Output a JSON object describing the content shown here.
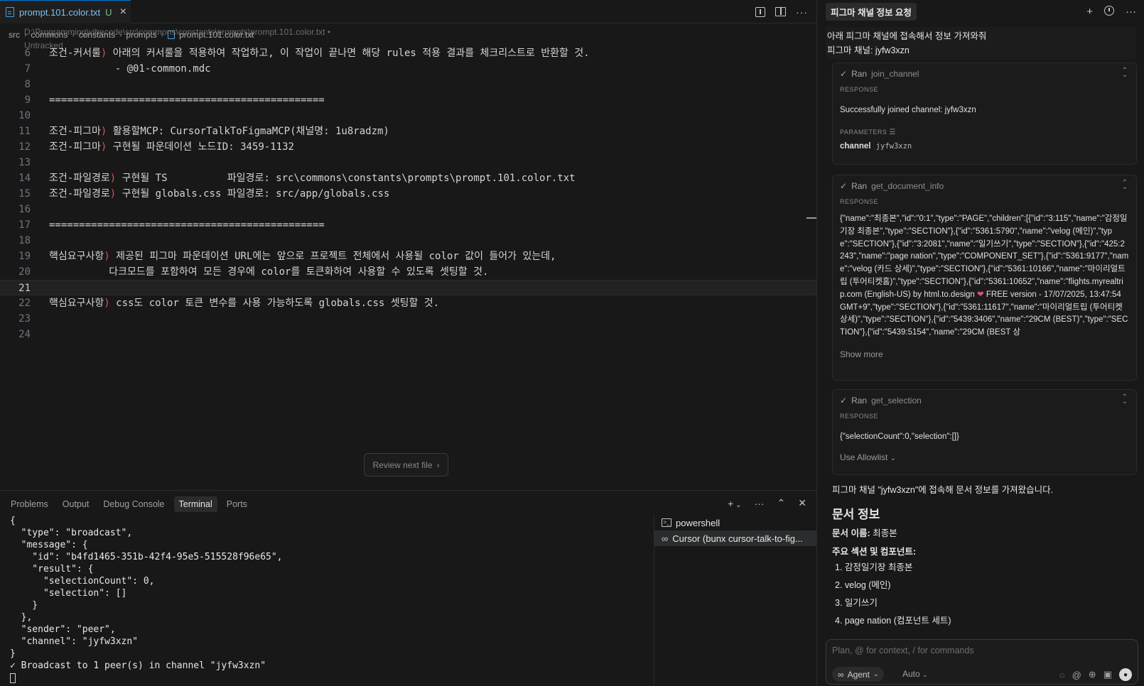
{
  "editor": {
    "tab": {
      "name": "prompt.101.color.txt",
      "status": "U"
    },
    "breadcrumb": [
      "src",
      "commons",
      "constants",
      "prompts",
      "prompt.101.color.txt"
    ],
    "hover_path": "D:\\Programming\\vibecode\\src\\commons\\constants\\prompts\\prompt.101.color.txt •",
    "hover_status": "Untracked",
    "lines": [
      {
        "n": "6",
        "kw": "조건-커서룰)",
        "text": " 아래의 커서룰을 적용하여 작업하고, 이 작업이 끝나면 해당 rules 적용 결과를 체크리스트로 반환할 것."
      },
      {
        "n": "7",
        "kw": "",
        "text": "           - @01-common.mdc"
      },
      {
        "n": "8",
        "kw": "",
        "text": ""
      },
      {
        "n": "9",
        "kw": "",
        "text": "=============================================="
      },
      {
        "n": "10",
        "kw": "",
        "text": ""
      },
      {
        "n": "11",
        "kw": "조건-피그마)",
        "text": " 활용할MCP: CursorTalkToFigmaMCP(채널명: 1u8radzm)"
      },
      {
        "n": "12",
        "kw": "조건-피그마)",
        "text": " 구현될 파운데이션 노드ID: 3459-1132"
      },
      {
        "n": "13",
        "kw": "",
        "text": ""
      },
      {
        "n": "14",
        "kw": "조건-파일경로)",
        "text": " 구현될 TS          파일경로: src\\commons\\constants\\prompts\\prompt.101.color.txt"
      },
      {
        "n": "15",
        "kw": "조건-파일경로)",
        "text": " 구현될 globals.css 파일경로: src/app/globals.css"
      },
      {
        "n": "16",
        "kw": "",
        "text": ""
      },
      {
        "n": "17",
        "kw": "",
        "text": "=============================================="
      },
      {
        "n": "18",
        "kw": "",
        "text": ""
      },
      {
        "n": "19",
        "kw": "핵심요구사항)",
        "text": " 제공된 피그마 파운데이션 URL에는 앞으로 프로젝트 전체에서 사용될 color 값이 들어가 있는데,"
      },
      {
        "n": "20",
        "kw": "",
        "text": "          다크모드를 포함하여 모든 경우에 color를 토큰화하여 사용할 수 있도록 셋팅할 것."
      },
      {
        "n": "21",
        "kw": "",
        "text": ""
      },
      {
        "n": "22",
        "kw": "핵심요구사항)",
        "text": " css도 color 토큰 변수를 사용 가능하도록 globals.css 셋팅할 것."
      },
      {
        "n": "23",
        "kw": "",
        "text": ""
      },
      {
        "n": "24",
        "kw": "",
        "text": ""
      }
    ],
    "review_button": "Review next file",
    "review_chevron": "›"
  },
  "panel": {
    "tabs": [
      "Problems",
      "Output",
      "Debug Console",
      "Terminal",
      "Ports"
    ],
    "active_tab": "Terminal",
    "terminal_lines": [
      "{",
      "  \"type\": \"broadcast\",",
      "  \"message\": {",
      "    \"id\": \"b4fd1465-351b-42f4-95e5-515528f96e65\",",
      "    \"result\": {",
      "      \"selectionCount\": 0,",
      "      \"selection\": []",
      "    }",
      "  },",
      "  \"sender\": \"peer\",",
      "  \"channel\": \"jyfw3xzn\"",
      "}",
      "✓ Broadcast to 1 peer(s) in channel \"jyfw3xzn\""
    ],
    "terminals": [
      {
        "icon": "powershell-icon",
        "label": "powershell"
      },
      {
        "icon": "infinity-icon",
        "label": "Cursor (bunx cursor-talk-to-fig..."
      }
    ],
    "actions": {
      "add": "+",
      "add_chevron": "⌄",
      "more": "···",
      "maximize": "⌃",
      "close": "✕"
    }
  },
  "chat": {
    "title": "피그마 채널 정보 요청",
    "user_message": [
      "아래 피그마 채널에 접속해서 정보 가져와줘",
      "피그마 채널: jyfw3xzn"
    ],
    "tools": [
      {
        "label": "Ran",
        "name": "join_channel",
        "response_label": "RESPONSE",
        "response": "Successfully joined channel: jyfw3xzn",
        "params_label": "PARAMETERS",
        "param_key": "channel",
        "param_value": "jyfw3xzn"
      },
      {
        "label": "Ran",
        "name": "get_document_info",
        "response_label": "RESPONSE",
        "response_pre": "{\"name\":\"최종본\",\"id\":\"0:1\",\"type\":\"PAGE\",\"children\":[{\"id\":\"3:115\",\"name\":\"감정일기장 최종본\",\"type\":\"SECTION\"},{\"id\":\"5361:5790\",\"name\":\"velog (메인)\",\"type\":\"SECTION\"},{\"id\":\"3:2081\",\"name\":\"일기쓰기\",\"type\":\"SECTION\"},{\"id\":\"425:2243\",\"name\":\"page nation\",\"type\":\"COMPONENT_SET\"},{\"id\":\"5361:9177\",\"name\":\"velog (카드 상세)\",\"type\":\"SECTION\"},{\"id\":\"5361:10166\",\"name\":\"마이리얼트립 (투어티켓홈)\",\"type\":\"SECTION\"},{\"id\":\"5361:10652\",\"name\":\"flights.myrealtrip.com (English-US) by html.to.design",
        "heart": "❤",
        "response_post": " FREE version - 17/07/2025, 13:47:54 GMT+9\",\"type\":\"SECTION\"},{\"id\":\"5361:11617\",\"name\":\"마이리얼트립 (투어티켓 상세)\",\"type\":\"SECTION\"},{\"id\":\"5439:3406\",\"name\":\"29CM (BEST)\",\"type\":\"SECTION\"},{\"id\":\"5439:5154\",\"name\":\"29CM (BEST 상",
        "show_more": "Show more"
      },
      {
        "label": "Ran",
        "name": "get_selection",
        "response_label": "RESPONSE",
        "response": "{\"selectionCount\":0,\"selection\":[]}",
        "allowlist": "Use Allowlist"
      }
    ],
    "assistant": {
      "intro": "피그마 채널 \"jyfw3xzn\"에 접속해 문서 정보를 가져왔습니다.",
      "heading": "문서 정보",
      "doc_name_label": "문서 이름:",
      "doc_name": " 최종본",
      "sections_label": "주요 섹션 및 컴포넌트:",
      "items": [
        "1. 감정일기장 최종본",
        "2. velog (메인)",
        "3. 일기쓰기",
        "4. page nation (컴포넌트 세트)"
      ]
    },
    "composer": {
      "placeholder": "Plan, @ for context, / for commands",
      "agent": "Agent",
      "auto": "Auto"
    }
  }
}
